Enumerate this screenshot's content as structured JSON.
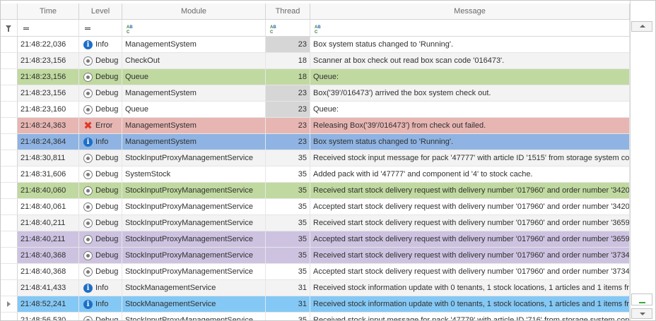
{
  "columns": [
    "Time",
    "Level",
    "Module",
    "Thread",
    "Message"
  ],
  "colors": {
    "green": "#c0d9a0",
    "red": "#e7b6b3",
    "blue": "#8fb4e3",
    "purple": "#cdc3e1",
    "sky": "#84c8f5",
    "grey": "#f3f3f3",
    "white": "#ffffff"
  },
  "filter_row": {
    "filter_icon": "funnel-icon",
    "time_condition": "equals-icon",
    "level_condition": "equals-icon",
    "module_condition": "abc-icon",
    "thread_condition": "abc-icon",
    "message_condition": "abc-icon"
  },
  "rows": [
    {
      "time": "21:48:22,036",
      "level": "Info",
      "icon": "info",
      "module": "ManagementSystem",
      "thread": "23",
      "message": "Box system status changed to 'Running'.",
      "bg": "white",
      "thread_hl": true
    },
    {
      "time": "21:48:23,156",
      "level": "Debug",
      "icon": "debug",
      "module": "CheckOut",
      "thread": "18",
      "message": "Scanner at box check out read box scan code '016473'.",
      "bg": "grey",
      "thread_hl": false
    },
    {
      "time": "21:48:23,156",
      "level": "Debug",
      "icon": "debug",
      "module": "Queue",
      "thread": "18",
      "message": "Queue:",
      "bg": "green",
      "thread_hl": false
    },
    {
      "time": "21:48:23,156",
      "level": "Debug",
      "icon": "debug",
      "module": "ManagementSystem",
      "thread": "23",
      "message": "Box('39'/016473') arrived the box system check out.",
      "bg": "grey",
      "thread_hl": true
    },
    {
      "time": "21:48:23,160",
      "level": "Debug",
      "icon": "debug",
      "module": "Queue",
      "thread": "23",
      "message": "Queue:",
      "bg": "white",
      "thread_hl": true
    },
    {
      "time": "21:48:24,363",
      "level": "Error",
      "icon": "error",
      "module": "ManagementSystem",
      "thread": "23",
      "message": "Releasing Box('39'/016473') from check out failed.",
      "bg": "red",
      "thread_hl": false
    },
    {
      "time": "21:48:24,364",
      "level": "Info",
      "icon": "info",
      "module": "ManagementSystem",
      "thread": "23",
      "message": "Box system status changed to 'Running'.",
      "bg": "blue",
      "thread_hl": false
    },
    {
      "time": "21:48:30,811",
      "level": "Debug",
      "icon": "debug",
      "module": "StockInputProxyManagementService",
      "thread": "35",
      "message": "Received stock input message for pack '47777' with article ID '1515' from storage system co",
      "bg": "grey",
      "thread_hl": false
    },
    {
      "time": "21:48:31,606",
      "level": "Debug",
      "icon": "debug",
      "module": "SystemStock",
      "thread": "35",
      "message": "Added pack with id '47777' and component id '4' to stock cache.",
      "bg": "white",
      "thread_hl": false
    },
    {
      "time": "21:48:40,060",
      "level": "Debug",
      "icon": "debug",
      "module": "StockInputProxyManagementService",
      "thread": "35",
      "message": "Received start stock delivery request with delivery number '017960' and order number '3420",
      "bg": "green",
      "thread_hl": false
    },
    {
      "time": "21:48:40,061",
      "level": "Debug",
      "icon": "debug",
      "module": "StockInputProxyManagementService",
      "thread": "35",
      "message": "Accepted start stock delivery request with delivery number '017960' and order number '3420",
      "bg": "white",
      "thread_hl": false
    },
    {
      "time": "21:48:40,211",
      "level": "Debug",
      "icon": "debug",
      "module": "StockInputProxyManagementService",
      "thread": "35",
      "message": "Received start stock delivery request with delivery number '017960' and order number '3659",
      "bg": "grey",
      "thread_hl": false
    },
    {
      "time": "21:48:40,211",
      "level": "Debug",
      "icon": "debug",
      "module": "StockInputProxyManagementService",
      "thread": "35",
      "message": "Accepted start stock delivery request with delivery number '017960' and order number '3659",
      "bg": "purple",
      "thread_hl": false
    },
    {
      "time": "21:48:40,368",
      "level": "Debug",
      "icon": "debug",
      "module": "StockInputProxyManagementService",
      "thread": "35",
      "message": "Received start stock delivery request with delivery number '017960' and order number '3734",
      "bg": "purple",
      "thread_hl": false
    },
    {
      "time": "21:48:40,368",
      "level": "Debug",
      "icon": "debug",
      "module": "StockInputProxyManagementService",
      "thread": "35",
      "message": "Accepted start stock delivery request with delivery number '017960' and order number '3734",
      "bg": "white",
      "thread_hl": false
    },
    {
      "time": "21:48:41,433",
      "level": "Info",
      "icon": "info",
      "module": "StockManagementService",
      "thread": "31",
      "message": "Received stock information update with 0 tenants, 1 stock locations, 1 articles and 1 items fr",
      "bg": "grey",
      "thread_hl": false
    },
    {
      "time": "21:48:52,241",
      "level": "Info",
      "icon": "info",
      "module": "StockManagementService",
      "thread": "31",
      "message": "Received stock information update with 0 tenants, 1 stock locations, 1 articles and 1 items fr",
      "bg": "sky",
      "thread_hl": false,
      "current": true
    },
    {
      "time": "21:48:56,530",
      "level": "Debug",
      "icon": "debug",
      "module": "StockInputProxyManagementService",
      "thread": "35",
      "message": "Received stock input message for pack '47779' with article ID '716' from storage system con",
      "bg": "white",
      "thread_hl": false
    }
  ]
}
